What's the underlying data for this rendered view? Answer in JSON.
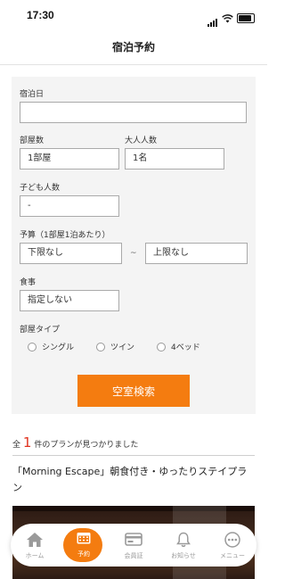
{
  "status_bar": {
    "time": "17:30"
  },
  "header": {
    "title": "宿泊予約"
  },
  "form": {
    "date_label": "宿泊日",
    "date_value": "",
    "rooms_label": "部屋数",
    "rooms_value": "1部屋",
    "adults_label": "大人人数",
    "adults_value": "1名",
    "children_label": "子ども人数",
    "children_value": "-",
    "budget_label": "予算（1部屋1泊あたり）",
    "budget_min": "下限なし",
    "budget_separator": "~",
    "budget_max": "上限なし",
    "meal_label": "食事",
    "meal_value": "指定しない",
    "room_type_label": "部屋タイプ",
    "room_types": [
      "シングル",
      "ツイン",
      "4ベッド"
    ],
    "search_button": "空室検索"
  },
  "results": {
    "prefix": "全",
    "count": "1",
    "suffix": "件のプランが見つかりました",
    "plan_title": "「Morning Escape」朝食付き・ゆったりステイプラン"
  },
  "tabs": [
    {
      "label": "ホーム",
      "icon": "home-icon"
    },
    {
      "label": "予約",
      "icon": "calendar-icon",
      "active": true
    },
    {
      "label": "会員証",
      "icon": "card-icon"
    },
    {
      "label": "お知らせ",
      "icon": "bell-icon"
    },
    {
      "label": "メニュー",
      "icon": "more-icon"
    }
  ],
  "colors": {
    "accent": "#f47c10",
    "count_red": "#e0321e",
    "form_bg": "#f4f4f4"
  }
}
